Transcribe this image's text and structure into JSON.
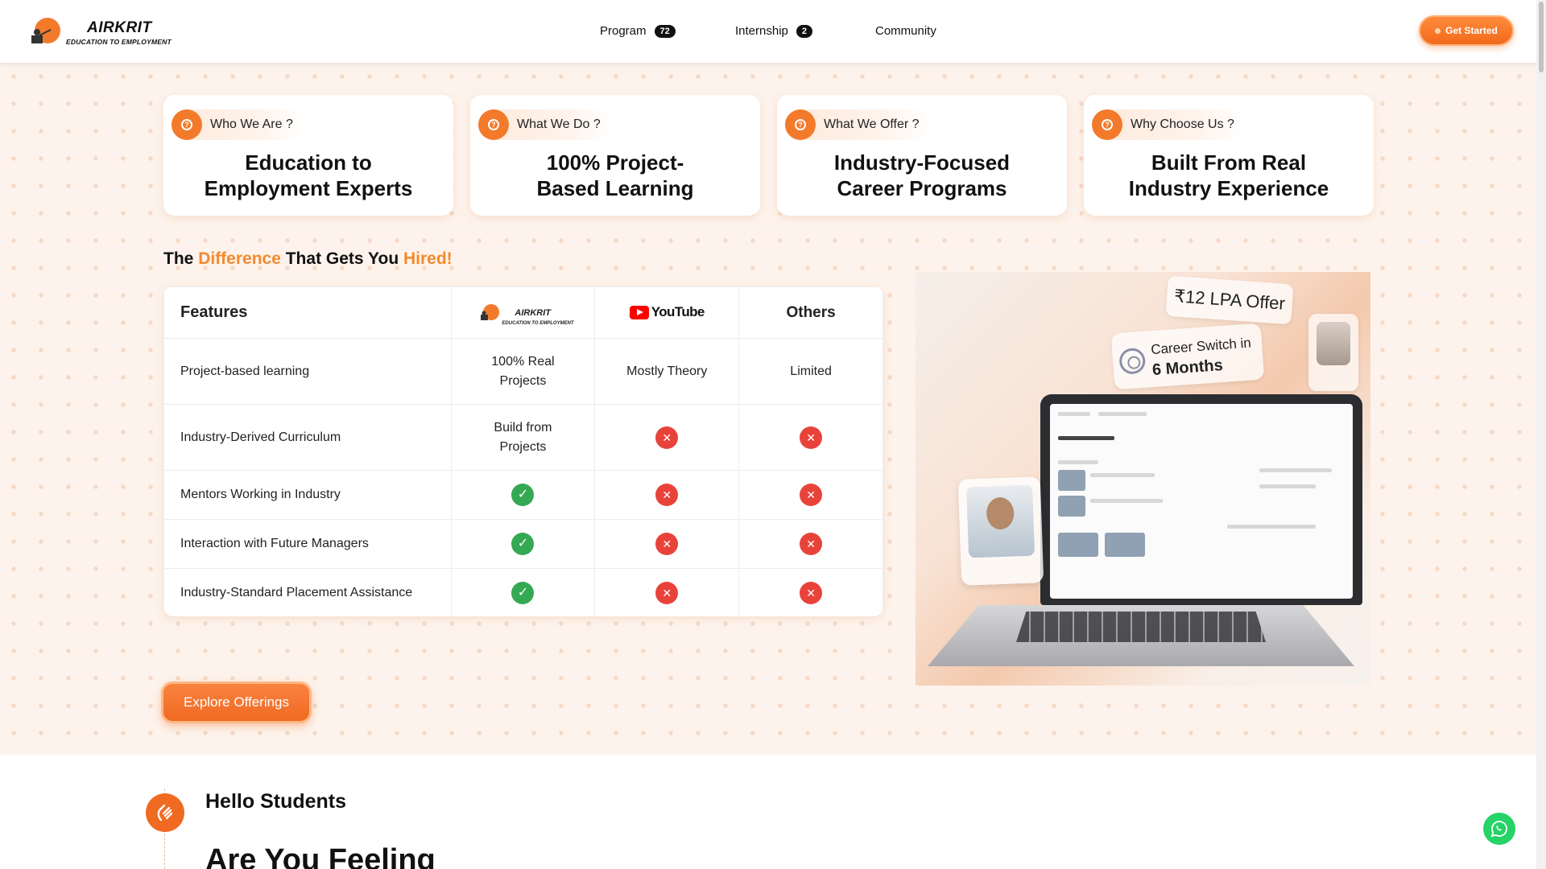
{
  "header": {
    "logo_main": "AIRKRIT",
    "logo_sub": "EDUCATION TO EMPLOYMENT",
    "nav": [
      {
        "label": "Program",
        "badge": "72"
      },
      {
        "label": "Internship",
        "badge": "2"
      },
      {
        "label": "Community",
        "badge": ""
      }
    ],
    "cta": "Get Started"
  },
  "info_cards": [
    {
      "question": "Who We Are ?",
      "title_l1": "Education to",
      "title_l2": "Employment Experts"
    },
    {
      "question": "What We Do ?",
      "title_l1": "100% Project-",
      "title_l2": "Based Learning"
    },
    {
      "question": "What We Offer ?",
      "title_l1": "Industry-Focused",
      "title_l2": "Career Programs"
    },
    {
      "question": "Why Choose Us ?",
      "title_l1": "Built From Real",
      "title_l2": "Industry Experience"
    }
  ],
  "difference": {
    "pre": "The",
    "hl1": "Difference",
    "mid": "That Gets You",
    "hl2": "Hired!"
  },
  "comparison": {
    "col_features": "Features",
    "col_airkrit": "AIRKRIT",
    "col_airkrit_sub": "EDUCATION TO EMPLOYMENT",
    "col_youtube": "YouTube",
    "col_others": "Others",
    "rows": [
      {
        "feature": "Project-based learning",
        "airkrit": "100% Real Projects",
        "youtube": "Mostly Theory",
        "others": "Limited"
      },
      {
        "feature": "Industry-Derived Curriculum",
        "airkrit": "Build from Projects",
        "youtube": "cross",
        "others": "cross"
      },
      {
        "feature": "Mentors Working in Industry",
        "airkrit": "check",
        "youtube": "cross",
        "others": "cross"
      },
      {
        "feature": "Interaction with Future Managers",
        "airkrit": "check",
        "youtube": "cross",
        "others": "cross"
      },
      {
        "feature": "Industry-Standard Placement Assistance",
        "airkrit": "check",
        "youtube": "cross",
        "others": "cross"
      }
    ]
  },
  "explore_button": "Explore Offerings",
  "hero": {
    "lpa_badge": "₹12 LPA Offer",
    "switch_l1": "Career Switch in",
    "switch_l2": "6 Months"
  },
  "hello": {
    "title": "Hello Students",
    "headline": "Are You Feeling"
  },
  "colors": {
    "accent": "#f37a2a",
    "check": "#35a853",
    "cross": "#e8433b",
    "whatsapp": "#25d366"
  }
}
